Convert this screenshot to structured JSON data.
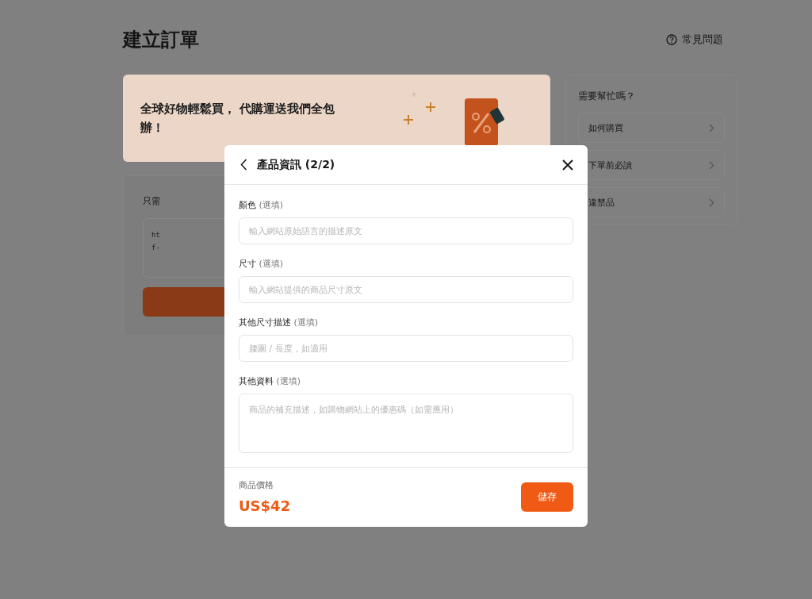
{
  "page": {
    "title": "建立訂單",
    "help_link": "常見問題"
  },
  "banner": {
    "text": "全球好物輕鬆買， 代購運送我們全包辦！"
  },
  "order_card": {
    "label": "只需",
    "url_lines": [
      "ht",
      "f-"
    ]
  },
  "help": {
    "title": "需要幫忙嗎？",
    "items": [
      "如何購買",
      "下單前必讀",
      "違禁品"
    ]
  },
  "modal": {
    "title": "產品資訊 (2/2)",
    "fields": [
      {
        "kind": "input",
        "label": "顏色",
        "optional": "(選填)",
        "placeholder": "輸入網站原始語言的描述原文"
      },
      {
        "kind": "input",
        "label": "尺寸",
        "optional": "(選填)",
        "placeholder": "輸入網站提供的商品尺寸原文"
      },
      {
        "kind": "input",
        "label": "其他尺寸描述",
        "optional": "(選填)",
        "placeholder": "腰圍 / 長度，如適用"
      },
      {
        "kind": "textarea",
        "label": "其他資料",
        "optional": "(選填)",
        "placeholder": "商品的補充描述，如購物網站上的優惠碼（如需應用）"
      }
    ],
    "price_label": "商品價格",
    "price": "US$42",
    "save": "儲存"
  }
}
